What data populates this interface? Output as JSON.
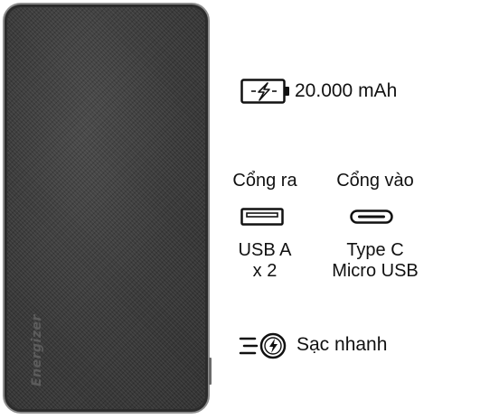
{
  "product": {
    "brand": "Energizer"
  },
  "features": {
    "capacity": {
      "icon": "battery-charging-icon",
      "value": "20.000 mAh"
    },
    "output": {
      "label": "Cổng ra",
      "icon": "usb-a-port-icon",
      "port_line1": "USB A",
      "port_line2": "x 2"
    },
    "input": {
      "label": "Cổng vào",
      "icon": "usb-c-port-icon",
      "port_line1": "Type C",
      "port_line2": "Micro USB"
    },
    "fast_charge": {
      "icon": "fast-charge-icon",
      "label": "Sạc nhanh"
    }
  }
}
